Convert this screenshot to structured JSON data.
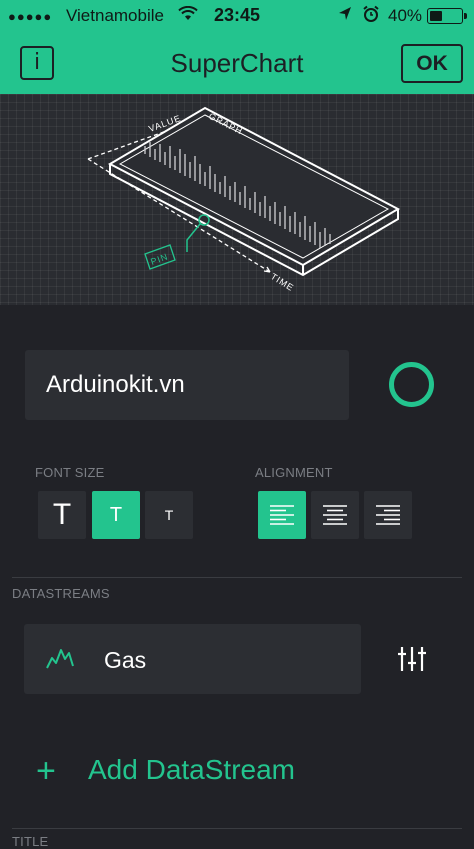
{
  "status_bar": {
    "signal": "●●●●●",
    "carrier": "Vietnamobile",
    "time": "23:45",
    "battery": "40%",
    "battery_level": 0.4
  },
  "nav": {
    "info_label": "i",
    "title": "SuperChart",
    "ok_label": "OK"
  },
  "illustration": {
    "value_label": "VALUE",
    "graph_label": "GRAPH",
    "pin_label": "PIN",
    "time_label": "TIME"
  },
  "widget_name": {
    "value": "Arduinokit.vn"
  },
  "colors": {
    "accent": "#23c48e",
    "background": "#212227",
    "field": "#2c2e33"
  },
  "font_size": {
    "label": "FONT SIZE",
    "options": [
      "T",
      "T",
      "T"
    ],
    "selected_index": 1
  },
  "alignment": {
    "label": "ALIGNMENT",
    "options": [
      "align-left-icon",
      "align-center-icon",
      "align-right-icon"
    ],
    "selected_index": 0
  },
  "datastreams": {
    "label": "DATASTREAMS",
    "items": [
      {
        "name": "Gas",
        "icon": "line-chart-icon"
      }
    ],
    "add_label": "Add DataStream"
  },
  "next_section": {
    "label": "TITLE"
  }
}
